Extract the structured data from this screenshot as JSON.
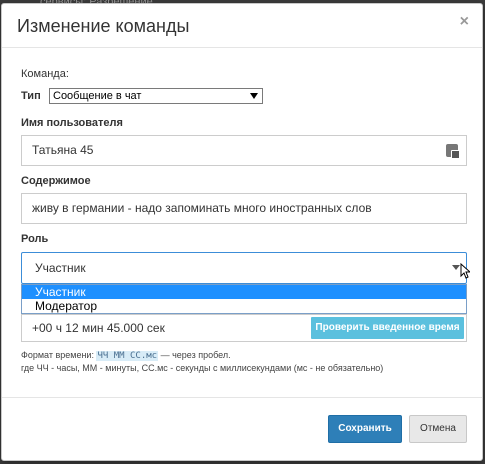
{
  "background": {
    "peek_text": "сервисы: Разрешение"
  },
  "modal": {
    "title": "Изменение команды",
    "close_glyph": "×"
  },
  "command": {
    "section_label": "Команда:",
    "type_label": "Тип",
    "type_value": "Сообщение в чат"
  },
  "username": {
    "label": "Имя пользователя",
    "value": "Татьяна 45"
  },
  "content": {
    "label": "Содержимое",
    "value": "живу в германии - надо запоминать много иностранных слов"
  },
  "role": {
    "label": "Роль",
    "selected": "Участник",
    "options": [
      "Участник",
      "Модератор"
    ]
  },
  "time": {
    "value": "+00 ч  12 мин  45.000 сек",
    "check_button": "Проверить введенное время"
  },
  "hint": {
    "prefix": "Формат времени:",
    "code": "ЧЧ ММ СС.мс",
    "suffix": " — через пробел.",
    "line2": "где ЧЧ - часы, ММ - минуты, СС.мс - секунды с миллисекундами (мс - не обязательно)"
  },
  "footer": {
    "save_label": "Сохранить",
    "cancel_label": "Отмена"
  },
  "colors": {
    "accent": "#2e7fb8",
    "info_button": "#5bc0de",
    "selected_option": "#1e90ff",
    "focus_border": "#3c8dd8"
  }
}
